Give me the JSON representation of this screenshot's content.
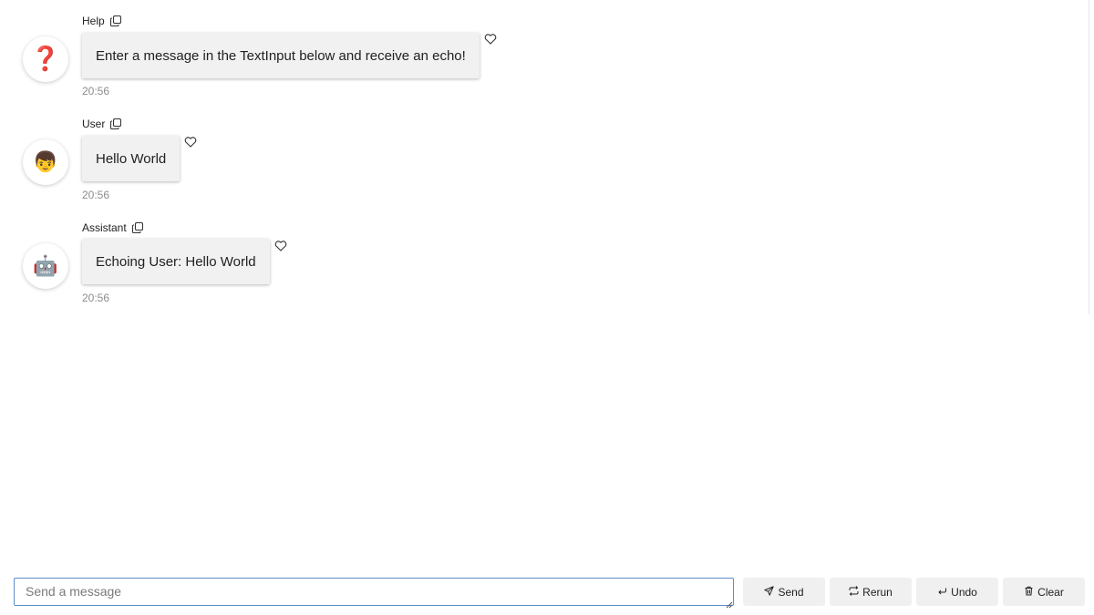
{
  "messages": [
    {
      "author": "Help",
      "avatar_icon": "question-mark-icon",
      "avatar_glyph": "❓",
      "text": "Enter a message in the TextInput below and receive an echo!",
      "time": "20:56"
    },
    {
      "author": "User",
      "avatar_icon": "person-icon",
      "avatar_glyph": "👦",
      "text": "Hello World",
      "time": "20:56"
    },
    {
      "author": "Assistant",
      "avatar_icon": "robot-icon",
      "avatar_glyph": "🤖",
      "text": "Echoing User: Hello World",
      "time": "20:56"
    }
  ],
  "composer": {
    "placeholder": "Send a message",
    "value": ""
  },
  "buttons": {
    "send": "Send",
    "rerun": "Rerun",
    "undo": "Undo",
    "clear": "Clear"
  },
  "colors": {
    "bubble": "#f1f1f1",
    "input_border": "#5b8dc9",
    "button": "#f0f0f0"
  }
}
